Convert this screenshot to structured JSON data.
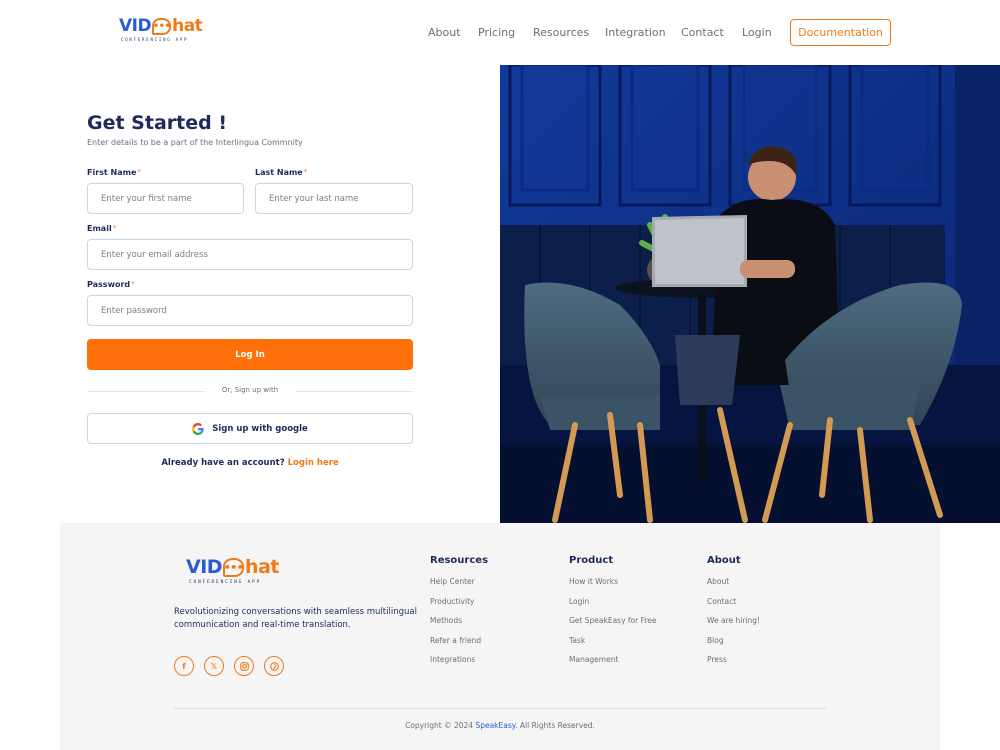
{
  "logo": {
    "vid": "VID",
    "c": "C",
    "hat": "hat",
    "subtitle": "CONFERENCING APP"
  },
  "nav": {
    "items": [
      "About",
      "Pricing",
      "Resources",
      "Integration",
      "Contact",
      "Login"
    ],
    "documentation": "Documentation"
  },
  "form": {
    "title": "Get Started !",
    "subtitle": "Enter details to be a part of the Interlingua Commnity",
    "first_name": {
      "label": "First Name",
      "placeholder": "Enter your first name"
    },
    "last_name": {
      "label": "Last Name",
      "placeholder": "Enter your last name"
    },
    "email": {
      "label": "Email",
      "placeholder": "Enter your email address"
    },
    "password": {
      "label": "Password",
      "placeholder": "Enter password"
    },
    "required_mark": "*",
    "login_button": "Log In",
    "divider_text": "Or, Sign up with",
    "google_button": "Sign up with google",
    "have_account": "Already have an account?",
    "login_here": "Login here"
  },
  "footer": {
    "tagline": "Revolutionizing conversations with seamless multilingual communication and real-time translation.",
    "socials": [
      "facebook-icon",
      "x-icon",
      "instagram-icon",
      "pinterest-icon"
    ],
    "columns": [
      {
        "title": "Resources",
        "links": [
          "Help Center",
          "Productivity",
          "Methods",
          "Refer a friend",
          "Integrations"
        ]
      },
      {
        "title": "Product",
        "links": [
          "How it Works",
          "Login",
          "Get SpeakEasy for Free",
          "Task",
          "Management"
        ]
      },
      {
        "title": "About",
        "links": [
          "About",
          "Contact",
          "We are hiring!",
          "Blog",
          "Press"
        ]
      }
    ],
    "copyright_prefix": "Copyright © 2024 ",
    "copyright_brand": "SpeakEasy",
    "copyright_suffix": ". All Rights Reserved."
  },
  "colors": {
    "accent": "#f07a18",
    "button": "#ff6f0a",
    "navy": "#1f2a5c",
    "brand_blue": "#2b5bd7",
    "photo_wall": "#0f2f8a"
  }
}
